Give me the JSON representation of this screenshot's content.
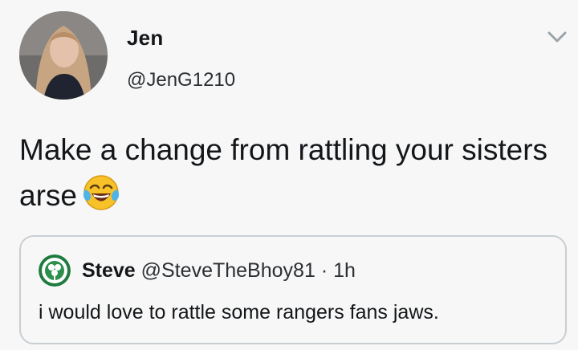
{
  "tweet": {
    "display_name": "Jen",
    "handle": "@JenG1210",
    "text": "Make a change from rattling your sisters arse",
    "emoji": "face-with-tears-of-joy"
  },
  "quoted_tweet": {
    "display_name": "Steve",
    "handle": "@SteveTheBhoy81",
    "separator": "·",
    "time": "1h",
    "text": "i would love to rattle some rangers fans jaws."
  },
  "icons": {
    "menu": "chevron-down-icon",
    "emoji": "tears-of-joy-emoji-icon"
  },
  "colors": {
    "text": "#14171a",
    "secondary": "#2a2f33",
    "border": "#c9ced2",
    "background": "#f7f7f7"
  }
}
